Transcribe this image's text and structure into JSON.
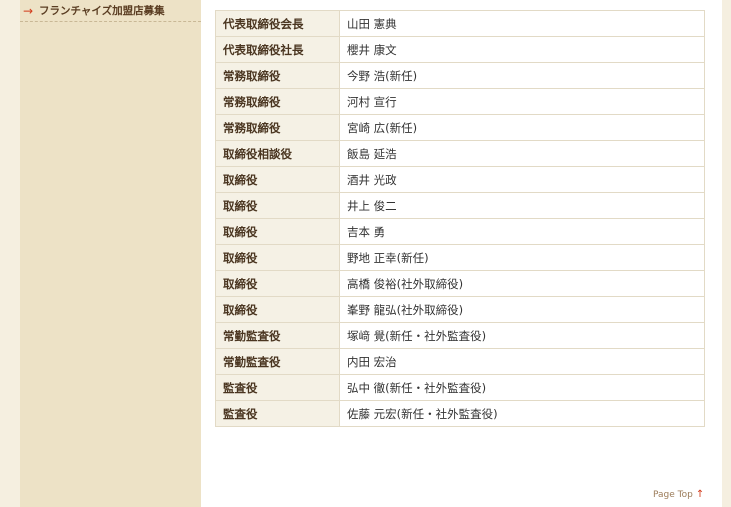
{
  "sidebar": {
    "items": [
      {
        "label": "フランチャイズ加盟店募集",
        "icon": "arrow-right-icon",
        "arrow_glyph": "→"
      }
    ]
  },
  "officers_table": {
    "rows": [
      {
        "title": "代表取締役会長",
        "name": "山田 憲典"
      },
      {
        "title": "代表取締役社長",
        "name": "櫻井 康文"
      },
      {
        "title": "常務取締役",
        "name": "今野 浩(新任)"
      },
      {
        "title": "常務取締役",
        "name": "河村 宣行"
      },
      {
        "title": "常務取締役",
        "name": "宮崎 広(新任)"
      },
      {
        "title": "取締役相談役",
        "name": "飯島 延浩"
      },
      {
        "title": "取締役",
        "name": "酒井 光政"
      },
      {
        "title": "取締役",
        "name": "井上 俊二"
      },
      {
        "title": "取締役",
        "name": "吉本 勇"
      },
      {
        "title": "取締役",
        "name": "野地 正幸(新任)"
      },
      {
        "title": "取締役",
        "name": "高橋 俊裕(社外取締役)"
      },
      {
        "title": "取締役",
        "name": "峯野 龍弘(社外取締役)"
      },
      {
        "title": "常勤監査役",
        "name": "塚﨑 覺(新任・社外監査役)"
      },
      {
        "title": "常勤監査役",
        "name": "内田 宏治"
      },
      {
        "title": "監査役",
        "name": "弘中 徹(新任・社外監査役)"
      },
      {
        "title": "監査役",
        "name": "佐藤 元宏(新任・社外監査役)"
      }
    ]
  },
  "page_top": {
    "label": "Page Top",
    "icon": "arrow-up-icon",
    "arrow_glyph": "↑"
  },
  "colors": {
    "sidebar_bg": "#ede2c6",
    "outer_bg": "#f5efe0",
    "title_cell_bg": "#f5f1e5",
    "accent_arrow": "#d23a1a"
  }
}
